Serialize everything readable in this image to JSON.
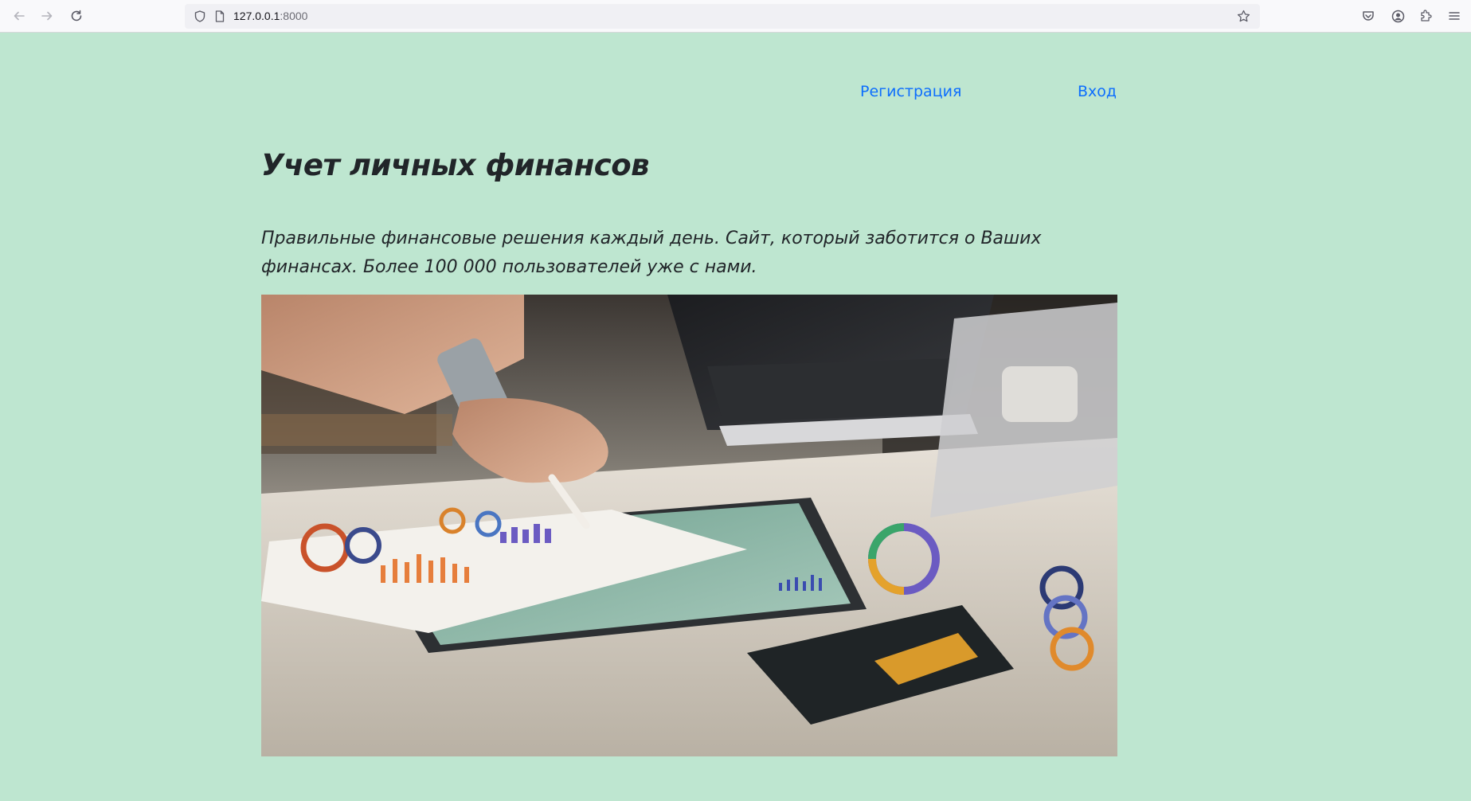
{
  "browser": {
    "url_host": "127.0.0.1",
    "url_port": ":8000",
    "icons": {
      "back": "arrow-left-icon",
      "forward": "arrow-right-icon",
      "reload": "reload-icon",
      "shield": "shield-icon",
      "page": "page-icon",
      "bookmark": "star-icon",
      "pocket": "pocket-icon",
      "account": "account-icon",
      "extensions": "puzzle-icon",
      "menu": "hamburger-menu-icon"
    }
  },
  "nav": {
    "register_label": "Регистрация",
    "login_label": "Вход"
  },
  "hero": {
    "title": "Учет личных финансов",
    "lead": "Правильные финансовые решения каждый день. Сайт, который заботится о Ваших финансах. Более 100 000 пользователей уже с нами."
  },
  "colors": {
    "page_background": "#bee6d0",
    "link": "#0d6efd",
    "text": "#212529"
  }
}
